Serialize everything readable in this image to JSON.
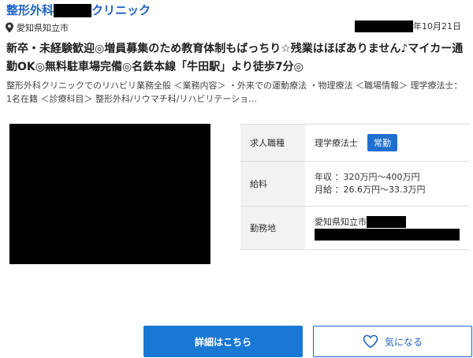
{
  "header": {
    "title_prefix": "整形外科",
    "title_suffix": "クリニック",
    "location": "愛知県知立市",
    "date": "年10月21日"
  },
  "headline": "新卒・未経験歓迎◎増員募集のため教育体制もばっちり☆残業はほぼありません♪マイカー通勤OK◎無料駐車場完備◎名鉄本線「牛田駅」より徒歩7分◎",
  "description": "整形外科クリニックでのリハビリ業務全般 ＜業務内容＞ ・外来での運動療法 ・物理療法 ＜職場情報＞ 理学療法士：1名在籍 ＜診療科目＞ 整形外科/リウマチ科/リハビリテーショ…",
  "details": {
    "job_label": "求人職種",
    "job_value": "理学療法士",
    "employment_badge": "常勤",
    "salary_label": "給料",
    "salary_annual": "年収 ：320万円～400万円",
    "salary_monthly": "月給 ：26.6万円～33.3万円",
    "workplace_label": "勤務地",
    "workplace_value": "愛知県知立市"
  },
  "actions": {
    "detail_button": "詳細はこちら",
    "favorite_button": "気になる"
  },
  "colors": {
    "brand_blue": "#1e63c4",
    "button_blue": "#1978d4",
    "badge_blue": "#1e6fd0"
  },
  "icons": {
    "location": "map-pin-icon",
    "favorite": "heart-icon"
  }
}
